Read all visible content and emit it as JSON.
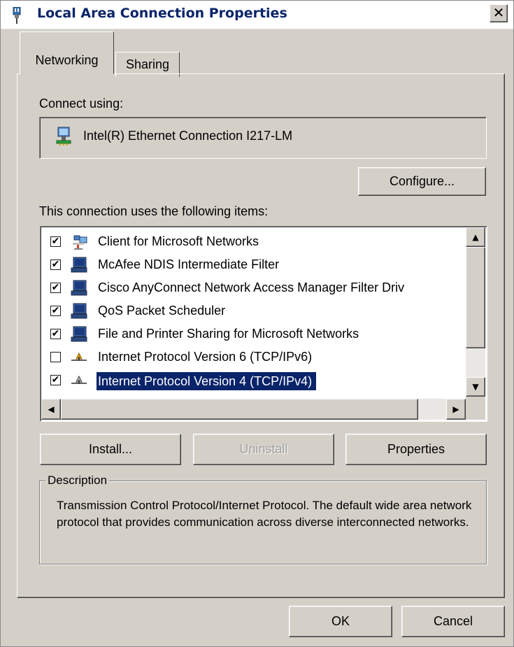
{
  "window": {
    "title": "Local Area Connection Properties",
    "close_glyph": "✕"
  },
  "tabs": [
    {
      "label": "Networking",
      "active": true
    },
    {
      "label": "Sharing",
      "active": false
    }
  ],
  "connect_using": {
    "label": "Connect using:",
    "adapter": "Intel(R) Ethernet Connection I217-LM",
    "adapter_icon": "network-adapter-icon"
  },
  "buttons": {
    "configure": "Configure...",
    "install": "Install...",
    "uninstall": "Uninstall",
    "properties": "Properties",
    "ok": "OK",
    "cancel": "Cancel"
  },
  "items_label": "This connection uses the following items:",
  "items": [
    {
      "label": "Client for Microsoft Networks",
      "checked": true,
      "icon": "client-network-icon",
      "check": "✔"
    },
    {
      "label": "McAfee NDIS Intermediate Filter",
      "checked": true,
      "icon": "service-computer-icon",
      "check": "✔"
    },
    {
      "label": "Cisco AnyConnect Network Access Manager Filter Driv",
      "checked": true,
      "icon": "service-computer-icon",
      "check": "✔"
    },
    {
      "label": "QoS Packet Scheduler",
      "checked": true,
      "icon": "service-computer-icon",
      "check": "✔"
    },
    {
      "label": "File and Printer Sharing for Microsoft Networks",
      "checked": true,
      "icon": "service-computer-icon",
      "check": "✔"
    },
    {
      "label": "Internet Protocol Version 6 (TCP/IPv6)",
      "checked": false,
      "icon": "protocol-icon",
      "check": ""
    },
    {
      "label": "Internet Protocol Version 4 (TCP/IPv4)",
      "checked": true,
      "icon": "protocol-icon",
      "check": "✔",
      "selected": true
    }
  ],
  "scroll": {
    "up": "▲",
    "down": "▼",
    "left": "◀",
    "right": "▶"
  },
  "description": {
    "title": "Description",
    "text": "Transmission Control Protocol/Internet Protocol. The default wide area network protocol that provides communication across diverse interconnected networks."
  },
  "colors": {
    "title_text": "#0a246a",
    "selection": "#0a246a",
    "face": "#d4d0c8"
  }
}
